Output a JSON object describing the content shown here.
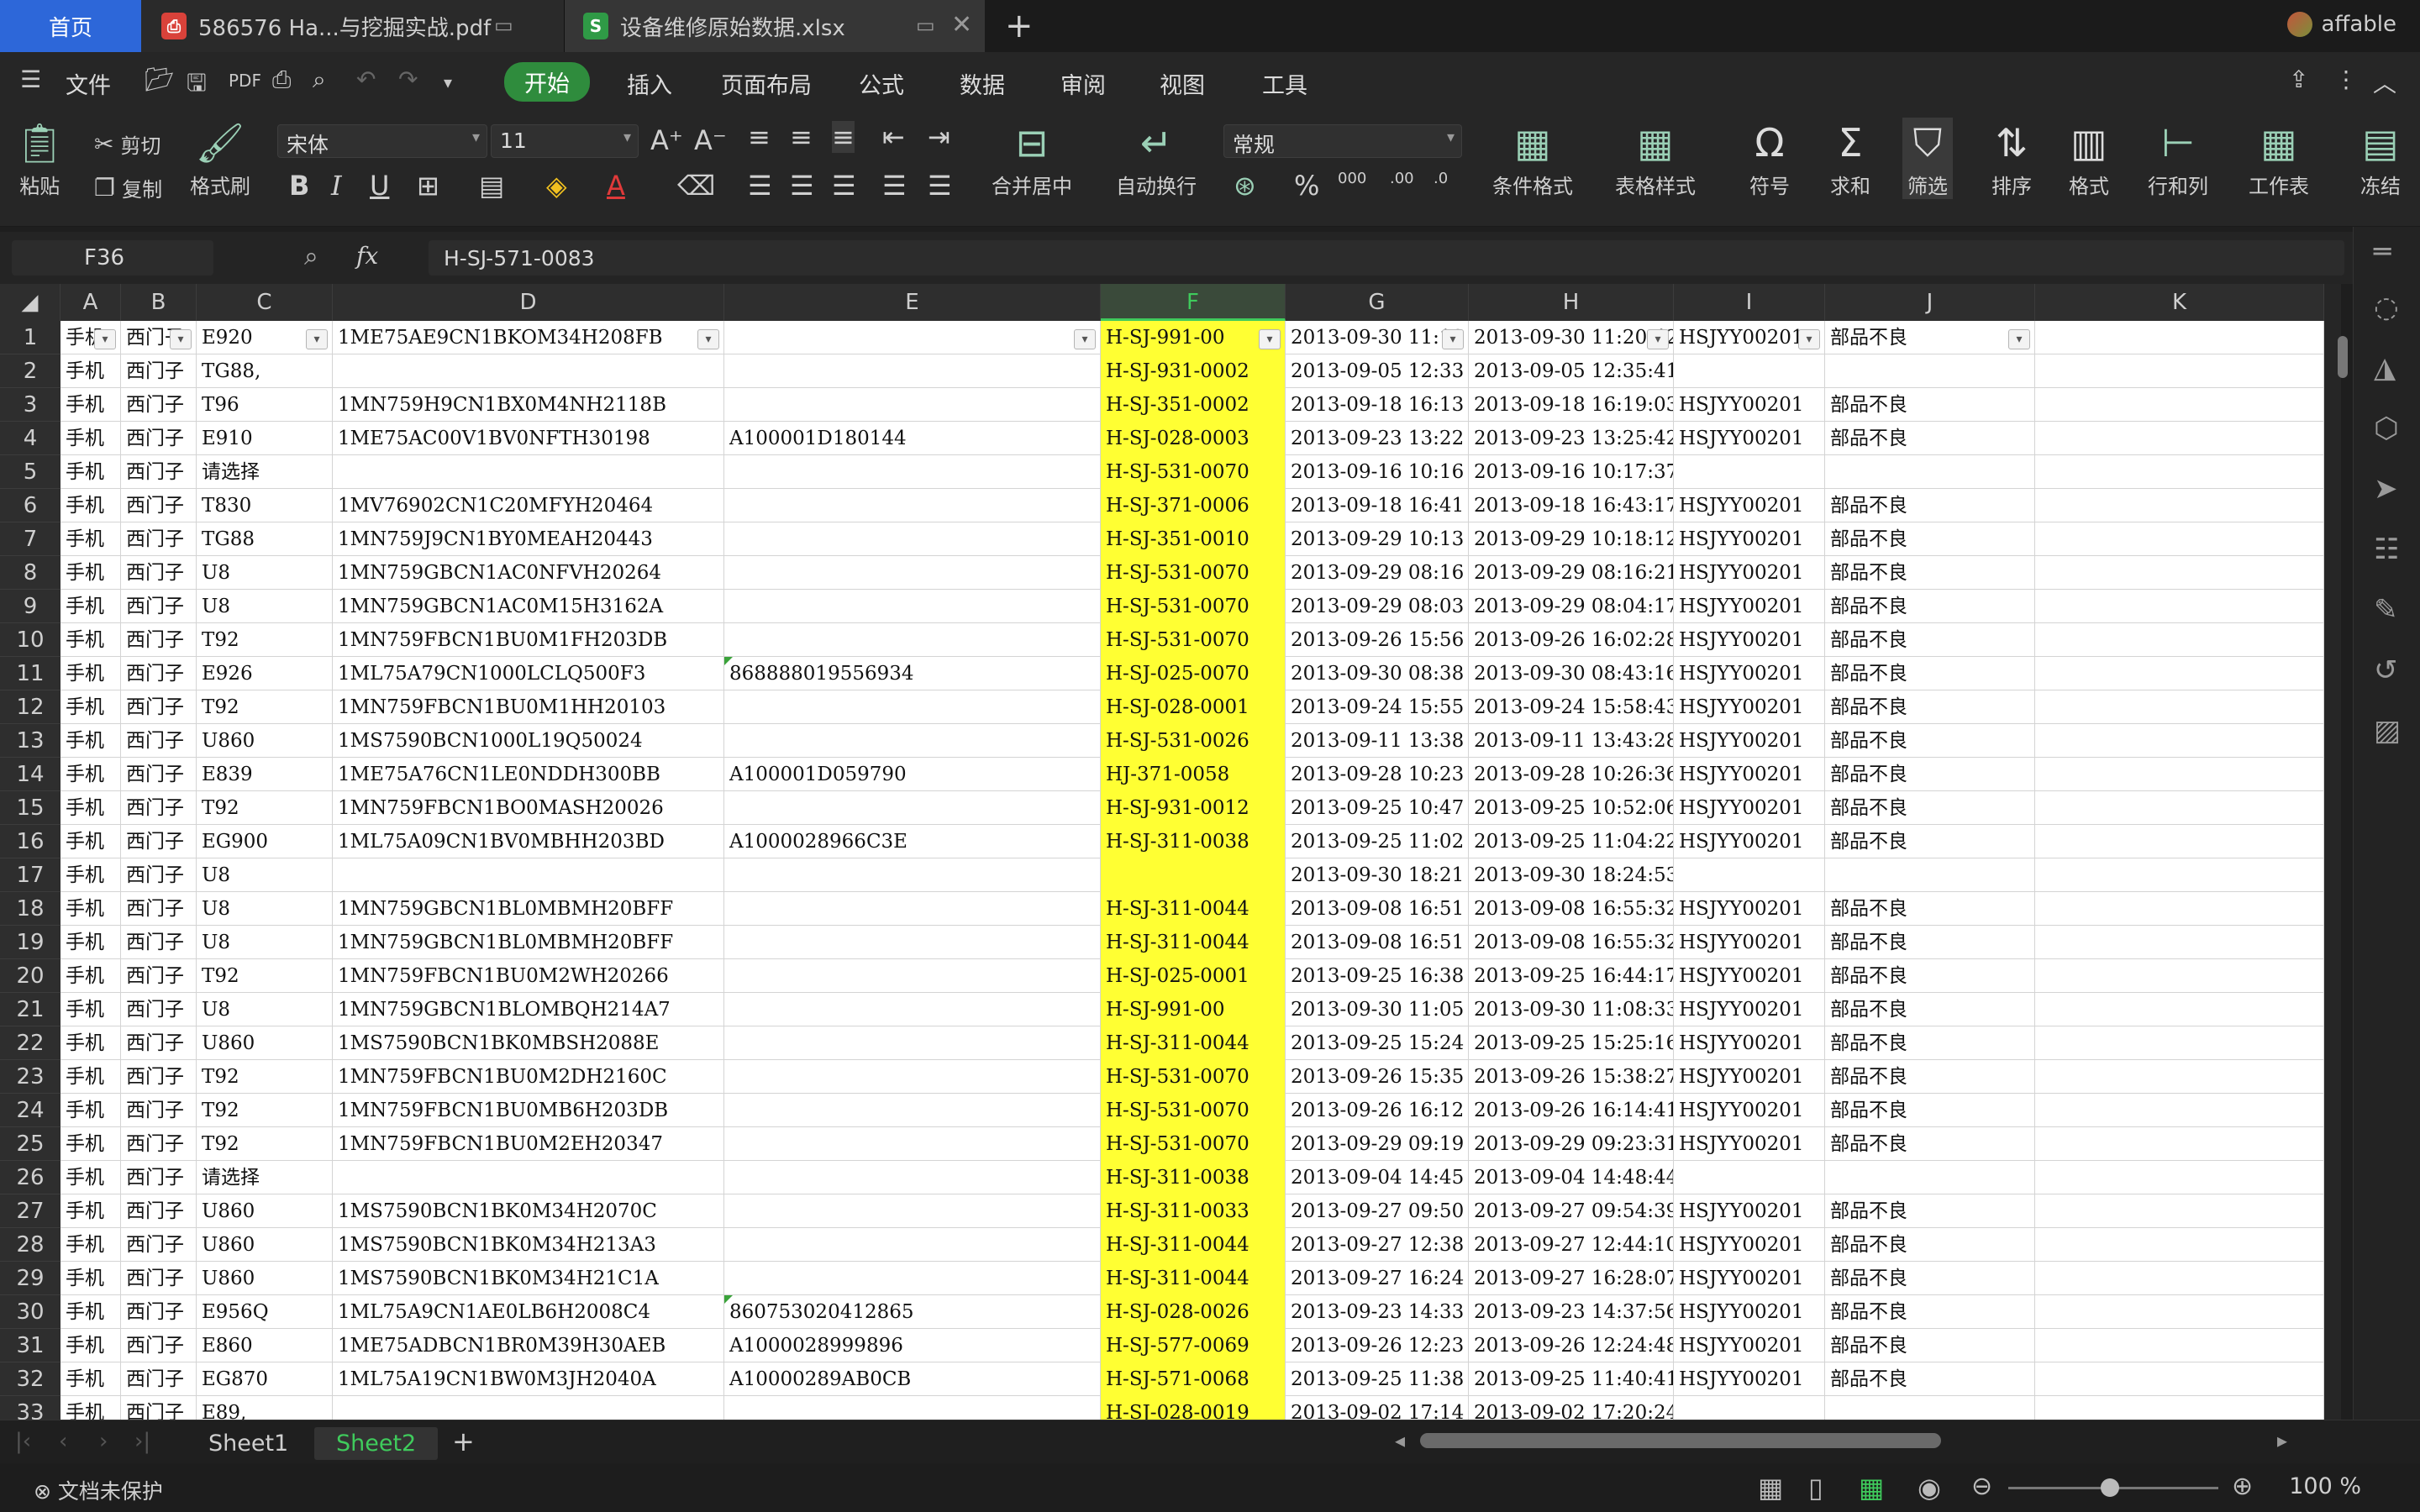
{
  "tabs": {
    "home": "首页",
    "pdf": "586576 Ha...与挖掘实战.pdf",
    "xlsx": "设备维修原始数据.xlsx",
    "new": "+",
    "user": "affable"
  },
  "menu": {
    "file": "文件",
    "items": [
      "开始",
      "插入",
      "页面布局",
      "公式",
      "数据",
      "审阅",
      "视图",
      "工具"
    ]
  },
  "ribbon": {
    "paste": "粘贴",
    "cut": "剪切",
    "copy": "复制",
    "format_painter": "格式刷",
    "font_name": "宋体",
    "font_size": "11",
    "merge_center": "合并居中",
    "wrap_text": "自动换行",
    "number_format": "常规",
    "conditional_format": "条件格式",
    "table_style": "表格样式",
    "symbol": "符号",
    "sum": "求和",
    "filter": "筛选",
    "sort": "排序",
    "format": "格式",
    "rows_cols": "行和列",
    "worksheet": "工作表",
    "freeze": "冻结"
  },
  "formula_bar": {
    "cell_ref": "F36",
    "fx": "fx",
    "content": "H-SJ-571-0083"
  },
  "grid": {
    "columns": [
      "A",
      "B",
      "C",
      "D",
      "E",
      "F",
      "G",
      "H",
      "I",
      "J",
      "K"
    ],
    "selected_column": "F",
    "highlight_color": "#ffff33",
    "rows": [
      [
        "手机",
        "西门子",
        "E920",
        "1ME75AE9CN1BKOM34H208FB",
        "",
        "H-SJ-991-00",
        "2013-09-30 11:18",
        "2013-09-30 11:20:42",
        "HSJYY00201",
        "部品不良"
      ],
      [
        "手机",
        "西门子",
        "TG88,",
        "",
        "",
        "H-SJ-931-0002",
        "2013-09-05 12:33",
        "2013-09-05 12:35:41",
        "",
        ""
      ],
      [
        "手机",
        "西门子",
        "T96",
        "1MN759H9CN1BX0M4NH2118B",
        "",
        "H-SJ-351-0002",
        "2013-09-18 16:13",
        "2013-09-18 16:19:03",
        "HSJYY00201",
        "部品不良"
      ],
      [
        "手机",
        "西门子",
        "E910",
        "1ME75AC00V1BV0NFTH30198",
        "A100001D180144",
        "H-SJ-028-0003",
        "2013-09-23 13:22",
        "2013-09-23 13:25:42",
        "HSJYY00201",
        "部品不良"
      ],
      [
        "手机",
        "西门子",
        "请选择",
        "",
        "",
        "H-SJ-531-0070",
        "2013-09-16 10:16",
        "2013-09-16 10:17:37",
        "",
        ""
      ],
      [
        "手机",
        "西门子",
        "T830",
        "1MV76902CN1C20MFYH20464",
        "",
        "H-SJ-371-0006",
        "2013-09-18 16:41",
        "2013-09-18 16:43:17",
        "HSJYY00201",
        "部品不良"
      ],
      [
        "手机",
        "西门子",
        "TG88",
        "1MN759J9CN1BY0MEAH20443",
        "",
        "H-SJ-351-0010",
        "2013-09-29 10:13",
        "2013-09-29 10:18:12",
        "HSJYY00201",
        "部品不良"
      ],
      [
        "手机",
        "西门子",
        "U8",
        "1MN759GBCN1AC0NFVH20264",
        "",
        "H-SJ-531-0070",
        "2013-09-29 08:16",
        "2013-09-29 08:16:21",
        "HSJYY00201",
        "部品不良"
      ],
      [
        "手机",
        "西门子",
        "U8",
        "1MN759GBCN1AC0M15H3162A",
        "",
        "H-SJ-531-0070",
        "2013-09-29 08:03",
        "2013-09-29 08:04:17",
        "HSJYY00201",
        "部品不良"
      ],
      [
        "手机",
        "西门子",
        "T92",
        "1MN759FBCN1BU0M1FH203DB",
        "",
        "H-SJ-531-0070",
        "2013-09-26 15:56",
        "2013-09-26 16:02:28",
        "HSJYY00201",
        "部品不良"
      ],
      [
        "手机",
        "西门子",
        "E926",
        "1ML75A79CN1000LCLQ500F3",
        "868888019556934",
        "H-SJ-025-0070",
        "2013-09-30 08:38",
        "2013-09-30 08:43:16",
        "HSJYY00201",
        "部品不良"
      ],
      [
        "手机",
        "西门子",
        "T92",
        "1MN759FBCN1BU0M1HH20103",
        "",
        "H-SJ-028-0001",
        "2013-09-24 15:55",
        "2013-09-24 15:58:43",
        "HSJYY00201",
        "部品不良"
      ],
      [
        "手机",
        "西门子",
        "U860",
        "1MS7590BCN1000L19Q50024",
        "",
        "H-SJ-531-0026",
        "2013-09-11 13:38",
        "2013-09-11 13:43:28",
        "HSJYY00201",
        "部品不良"
      ],
      [
        "手机",
        "西门子",
        "E839",
        "1ME75A76CN1LE0NDDH300BB",
        "A100001D059790",
        "HJ-371-0058",
        "2013-09-28 10:23",
        "2013-09-28 10:26:36",
        "HSJYY00201",
        "部品不良"
      ],
      [
        "手机",
        "西门子",
        "T92",
        "1MN759FBCN1BO0MASH20026",
        "",
        "H-SJ-931-0012",
        "2013-09-25 10:47",
        "2013-09-25 10:52:06",
        "HSJYY00201",
        "部品不良"
      ],
      [
        "手机",
        "西门子",
        "EG900",
        "1ML75A09CN1BV0MBHH203BD",
        "A1000028966C3E",
        "H-SJ-311-0038",
        "2013-09-25 11:02",
        "2013-09-25 11:04:22",
        "HSJYY00201",
        "部品不良"
      ],
      [
        "手机",
        "西门子",
        "U8",
        "",
        "",
        "",
        "2013-09-30 18:21",
        "2013-09-30 18:24:53",
        "",
        ""
      ],
      [
        "手机",
        "西门子",
        "U8",
        "1MN759GBCN1BL0MBMH20BFF",
        "",
        "H-SJ-311-0044",
        "2013-09-08 16:51",
        "2013-09-08 16:55:32",
        "HSJYY00201",
        "部品不良"
      ],
      [
        "手机",
        "西门子",
        "U8",
        "1MN759GBCN1BL0MBMH20BFF",
        "",
        "H-SJ-311-0044",
        "2013-09-08 16:51",
        "2013-09-08 16:55:32",
        "HSJYY00201",
        "部品不良"
      ],
      [
        "手机",
        "西门子",
        "T92",
        "1MN759FBCN1BU0M2WH20266",
        "",
        "H-SJ-025-0001",
        "2013-09-25 16:38",
        "2013-09-25 16:44:17",
        "HSJYY00201",
        "部品不良"
      ],
      [
        "手机",
        "西门子",
        "U8",
        "1MN759GBCN1BLOMBQH214A7",
        "",
        "H-SJ-991-00",
        "2013-09-30 11:05",
        "2013-09-30 11:08:33",
        "HSJYY00201",
        "部品不良"
      ],
      [
        "手机",
        "西门子",
        "U860",
        "1MS7590BCN1BK0MBSH2088E",
        "",
        "H-SJ-311-0044",
        "2013-09-25 15:24",
        "2013-09-25 15:25:16",
        "HSJYY00201",
        "部品不良"
      ],
      [
        "手机",
        "西门子",
        "T92",
        "1MN759FBCN1BU0M2DH2160C",
        "",
        "H-SJ-531-0070",
        "2013-09-26 15:35",
        "2013-09-26 15:38:27",
        "HSJYY00201",
        "部品不良"
      ],
      [
        "手机",
        "西门子",
        "T92",
        "1MN759FBCN1BU0MB6H203DB",
        "",
        "H-SJ-531-0070",
        "2013-09-26 16:12",
        "2013-09-26 16:14:41",
        "HSJYY00201",
        "部品不良"
      ],
      [
        "手机",
        "西门子",
        "T92",
        "1MN759FBCN1BU0M2EH20347",
        "",
        "H-SJ-531-0070",
        "2013-09-29 09:19",
        "2013-09-29 09:23:31",
        "HSJYY00201",
        "部品不良"
      ],
      [
        "手机",
        "西门子",
        "请选择",
        "",
        "",
        "H-SJ-311-0038",
        "2013-09-04 14:45",
        "2013-09-04 14:48:44",
        "",
        ""
      ],
      [
        "手机",
        "西门子",
        "U860",
        "1MS7590BCN1BK0M34H2070C",
        "",
        "H-SJ-311-0033",
        "2013-09-27 09:50",
        "2013-09-27 09:54:39",
        "HSJYY00201",
        "部品不良"
      ],
      [
        "手机",
        "西门子",
        "U860",
        "1MS7590BCN1BK0M34H213A3",
        "",
        "H-SJ-311-0044",
        "2013-09-27 12:38",
        "2013-09-27 12:44:10",
        "HSJYY00201",
        "部品不良"
      ],
      [
        "手机",
        "西门子",
        "U860",
        "1MS7590BCN1BK0M34H21C1A",
        "",
        "H-SJ-311-0044",
        "2013-09-27 16:24",
        "2013-09-27 16:28:07",
        "HSJYY00201",
        "部品不良"
      ],
      [
        "手机",
        "西门子",
        "E956Q",
        "1ML75A9CN1AE0LB6H2008C4",
        "860753020412865",
        "H-SJ-028-0026",
        "2013-09-23 14:33",
        "2013-09-23 14:37:56",
        "HSJYY00201",
        "部品不良"
      ],
      [
        "手机",
        "西门子",
        "E860",
        "1ME75ADBCN1BR0M39H30AEB",
        "A1000028999896",
        "H-SJ-577-0069",
        "2013-09-26 12:23",
        "2013-09-26 12:24:48",
        "HSJYY00201",
        "部品不良"
      ],
      [
        "手机",
        "西门子",
        "EG870",
        "1ML75A19CN1BW0M3JH2040A",
        "A10000289AB0CB",
        "H-SJ-571-0068",
        "2013-09-25 11:38",
        "2013-09-25 11:40:41",
        "HSJYY00201",
        "部品不良"
      ],
      [
        "手机",
        "西门子",
        "E89,",
        "",
        "",
        "H-SJ-028-0019",
        "2013-09-02 17:14",
        "2013-09-02 17:20:24",
        "",
        ""
      ]
    ]
  },
  "sheets": {
    "sheet1": "Sheet1",
    "sheet2": "Sheet2",
    "add": "+"
  },
  "status": {
    "doc": "文档未保护",
    "zoom": "100 %"
  }
}
